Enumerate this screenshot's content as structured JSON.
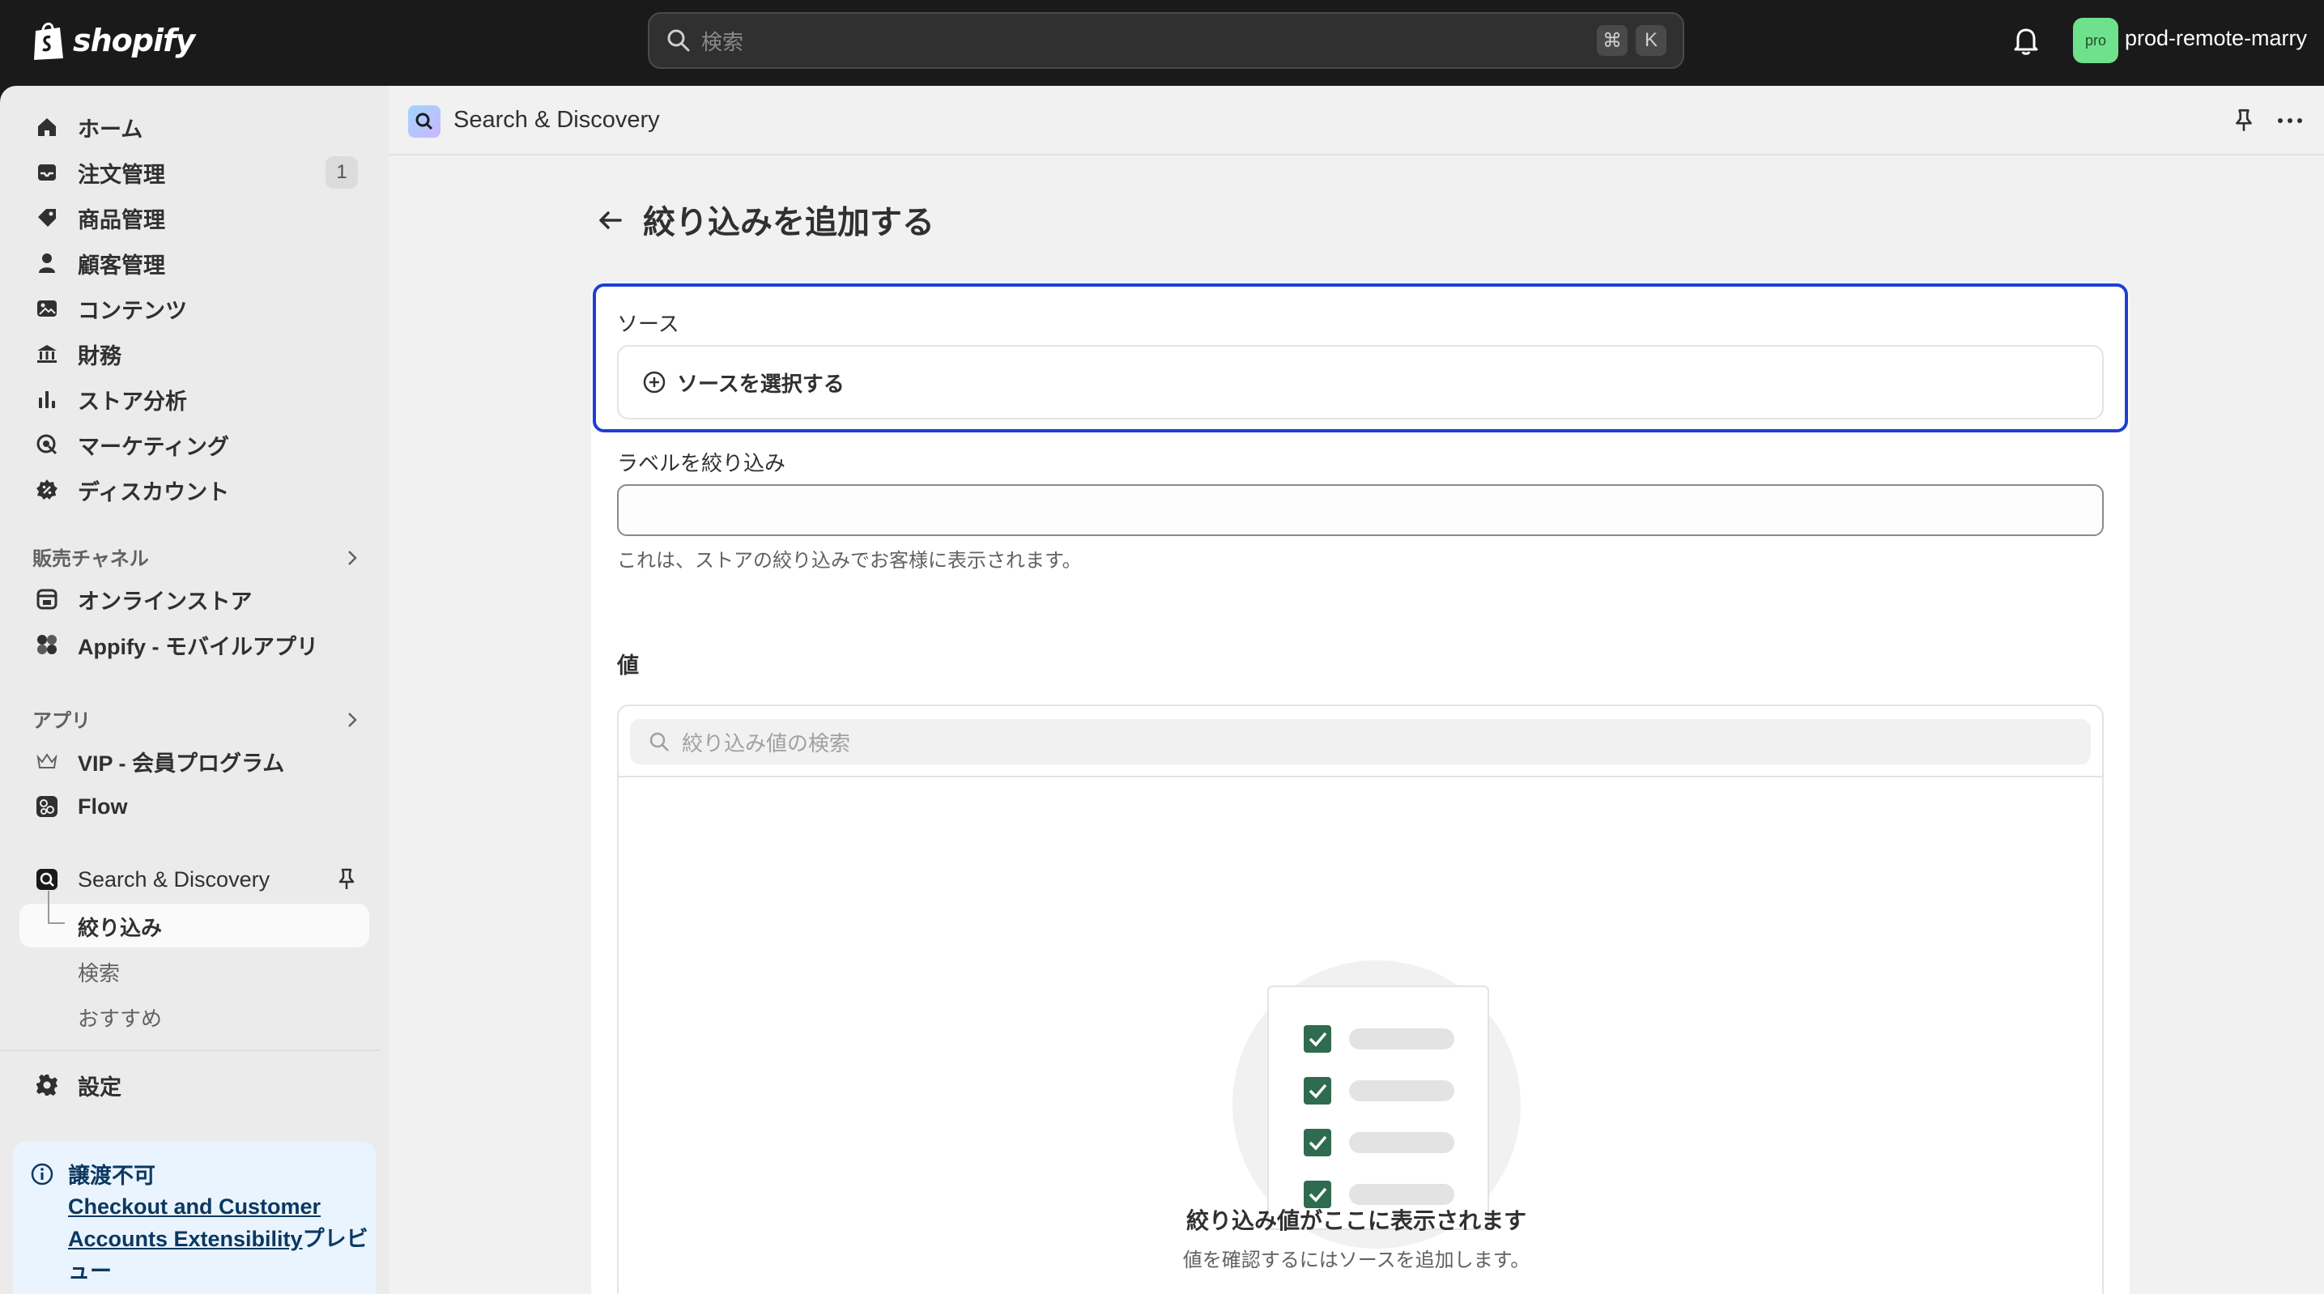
{
  "topbar": {
    "logo_text": "shopify",
    "search_placeholder": "検索",
    "shortcut_cmd": "⌘",
    "shortcut_key": "K",
    "avatar_initials": "pro",
    "store_name": "prod-remote-marry"
  },
  "sidebar": {
    "items": [
      {
        "label": "ホーム",
        "icon": "home-icon"
      },
      {
        "label": "注文管理",
        "icon": "inbox-icon",
        "badge": "1"
      },
      {
        "label": "商品管理",
        "icon": "tag-icon"
      },
      {
        "label": "顧客管理",
        "icon": "person-icon"
      },
      {
        "label": "コンテンツ",
        "icon": "image-icon"
      },
      {
        "label": "財務",
        "icon": "bank-icon"
      },
      {
        "label": "ストア分析",
        "icon": "bar-chart-icon"
      },
      {
        "label": "マーケティング",
        "icon": "target-icon"
      },
      {
        "label": "ディスカウント",
        "icon": "discount-icon"
      }
    ],
    "sales_channels_label": "販売チャネル",
    "channels": [
      {
        "label": "オンラインストア",
        "icon": "store-icon"
      },
      {
        "label": "Appify - モバイルアプリ",
        "icon": "app-icon"
      }
    ],
    "apps_label": "アプリ",
    "apps": [
      {
        "label": "VIP - 会員プログラム",
        "icon": "crown-icon"
      },
      {
        "label": "Flow",
        "icon": "flow-icon"
      },
      {
        "label": "Search & Discovery",
        "icon": "search-discovery-icon"
      }
    ],
    "sub_items": [
      "絞り込み",
      "検索",
      "おすすめ"
    ],
    "settings_label": "設定",
    "notice": {
      "title": "譲渡不可",
      "link_text": "Checkout and Customer Accounts Extensibility",
      "suffix": "プレビュー"
    }
  },
  "appbar": {
    "title": "Search & Discovery"
  },
  "page": {
    "title": "絞り込みを追加する",
    "source_label": "ソース",
    "source_button": "ソースを選択する",
    "filter_label_label": "ラベルを絞り込み",
    "filter_label_value": "",
    "filter_label_help": "これは、ストアの絞り込みでお客様に表示されます。",
    "values_title": "値",
    "values_search_placeholder": "絞り込み値の検索",
    "empty_title": "絞り込み値がここに表示されます",
    "empty_subtitle": "値を確認するにはソースを追加します。"
  },
  "colors": {
    "focus_ring": "#1c3fd4",
    "check_green": "#2e6b4f",
    "avatar_bg": "#6fe08c"
  }
}
